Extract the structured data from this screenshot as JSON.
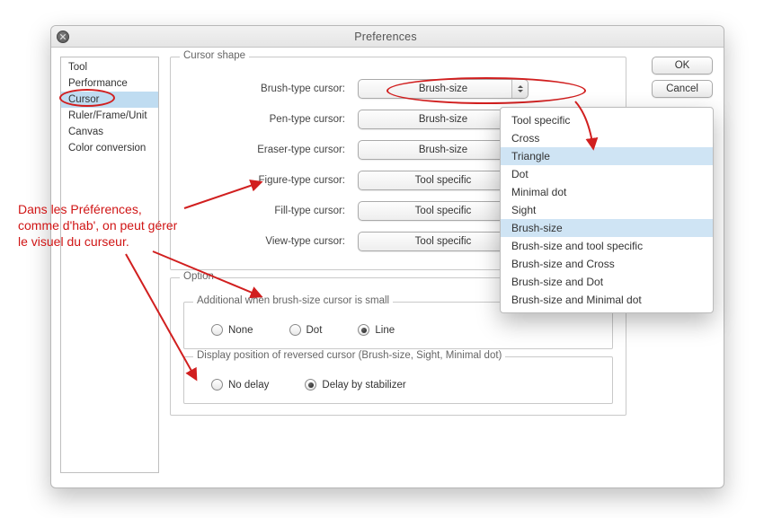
{
  "window": {
    "title": "Preferences"
  },
  "buttons": {
    "ok": "OK",
    "cancel": "Cancel"
  },
  "sidebar": {
    "items": [
      {
        "label": "Tool"
      },
      {
        "label": "Performance"
      },
      {
        "label": "Cursor",
        "selected": true
      },
      {
        "label": "Ruler/Frame/Unit"
      },
      {
        "label": "Canvas"
      },
      {
        "label": "Color conversion"
      }
    ]
  },
  "cursor_shape": {
    "legend": "Cursor shape",
    "rows": [
      {
        "label": "Brush-type cursor:",
        "value": "Brush-size"
      },
      {
        "label": "Pen-type cursor:",
        "value": "Brush-size"
      },
      {
        "label": "Eraser-type cursor:",
        "value": "Brush-size"
      },
      {
        "label": "Figure-type cursor:",
        "value": "Tool specific"
      },
      {
        "label": "Fill-type cursor:",
        "value": "Tool specific"
      },
      {
        "label": "View-type cursor:",
        "value": "Tool specific"
      }
    ]
  },
  "option": {
    "legend": "Option",
    "additional": {
      "legend": "Additional when brush-size cursor is small",
      "choices": [
        {
          "label": "None",
          "selected": false
        },
        {
          "label": "Dot",
          "selected": false
        },
        {
          "label": "Line",
          "selected": true
        }
      ]
    },
    "display_pos": {
      "legend": "Display position of reversed cursor (Brush-size, Sight, Minimal dot)",
      "choices": [
        {
          "label": "No delay",
          "selected": false
        },
        {
          "label": "Delay by stabilizer",
          "selected": true
        }
      ]
    }
  },
  "dropdown": {
    "items": [
      "Tool specific",
      "Cross",
      "Triangle",
      "Dot",
      "Minimal dot",
      "Sight",
      "Brush-size",
      "Brush-size and tool specific",
      "Brush-size and Cross",
      "Brush-size and Dot",
      "Brush-size and Minimal dot"
    ],
    "highlighted": "Brush-size",
    "also_hi": "Triangle"
  },
  "annotation": {
    "line1": "Dans les Préférences,",
    "line2": "comme d'hab', on peut gérer",
    "line3": "le visuel du curseur."
  },
  "colors": {
    "annot_red": "#d11f1f",
    "selection_blue": "#bfdcf1"
  }
}
